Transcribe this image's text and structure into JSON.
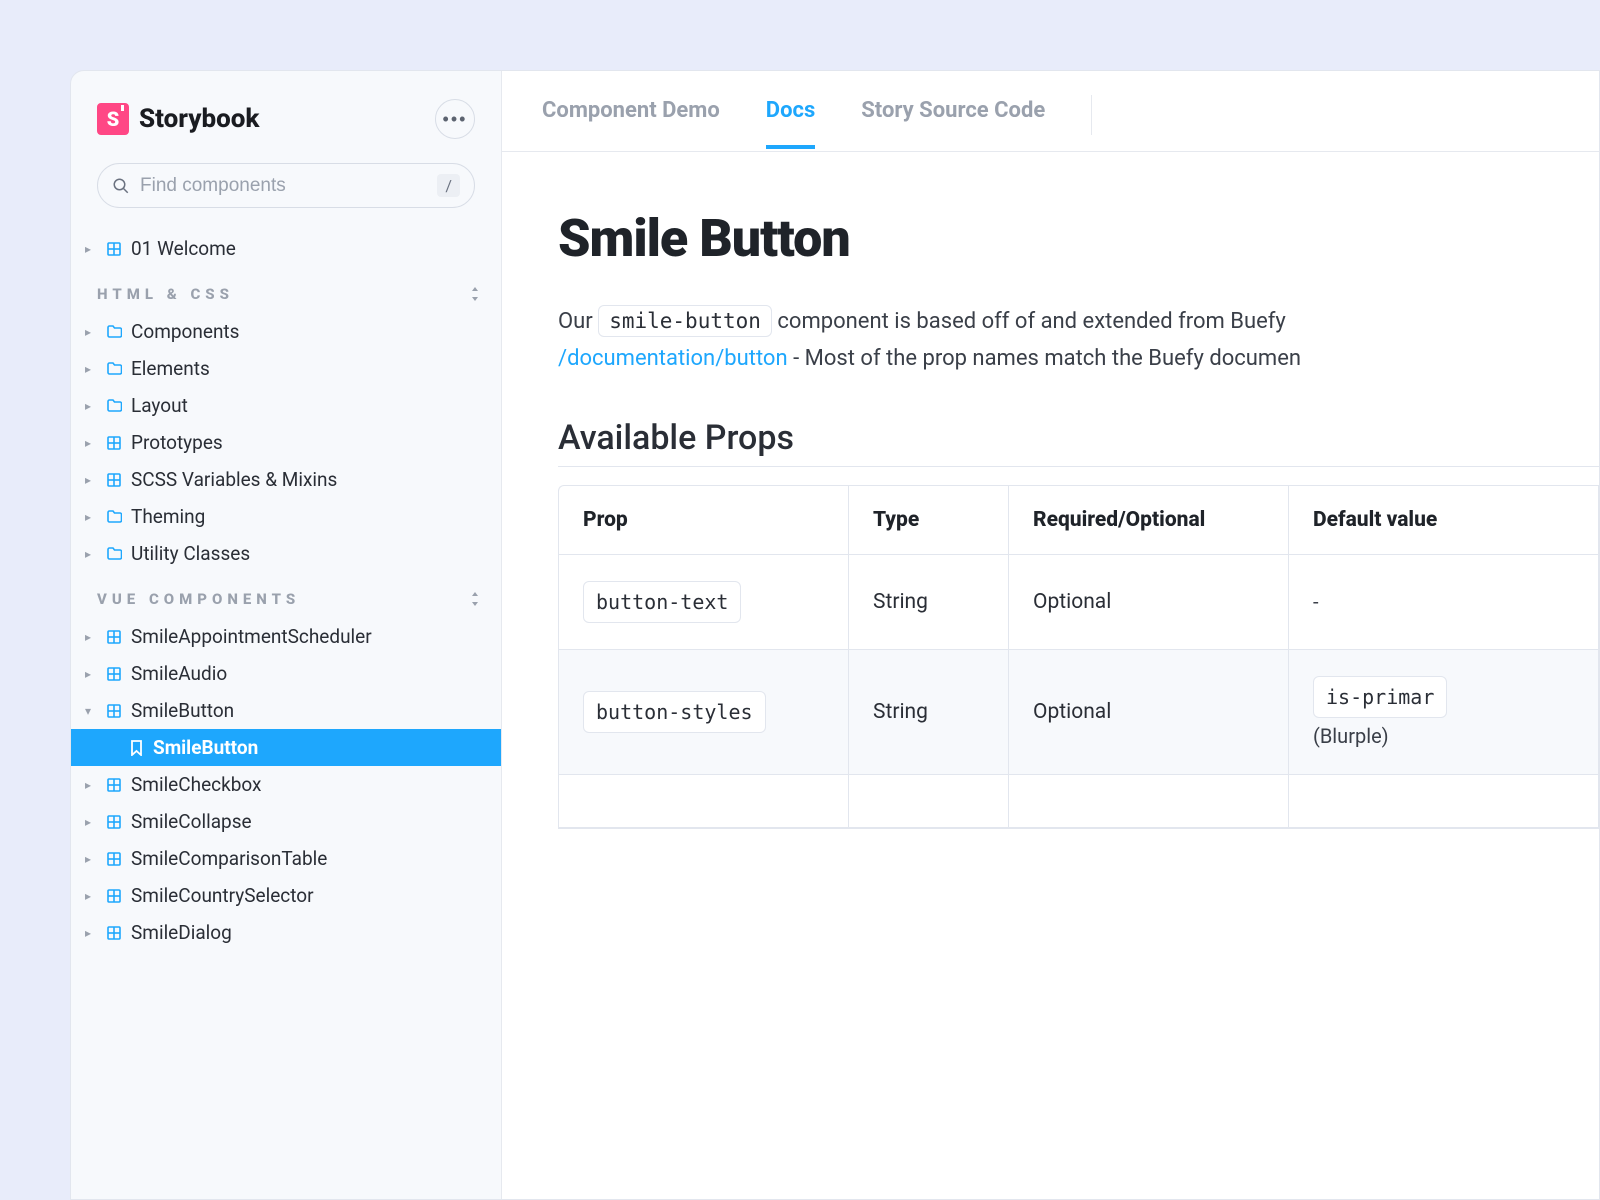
{
  "brand": {
    "name": "Storybook",
    "logo_letter": "S"
  },
  "menu_button": "•••",
  "search": {
    "placeholder": "Find components",
    "shortcut": "/"
  },
  "sidebar": {
    "top_item": {
      "label": "01 Welcome",
      "icon": "grid"
    },
    "sections": [
      {
        "title": "HTML & CSS",
        "items": [
          {
            "label": "Components",
            "icon": "folder"
          },
          {
            "label": "Elements",
            "icon": "folder"
          },
          {
            "label": "Layout",
            "icon": "folder"
          },
          {
            "label": "Prototypes",
            "icon": "grid"
          },
          {
            "label": "SCSS Variables & Mixins",
            "icon": "grid"
          },
          {
            "label": "Theming",
            "icon": "folder"
          },
          {
            "label": "Utility Classes",
            "icon": "folder"
          }
        ]
      },
      {
        "title": "VUE COMPONENTS",
        "items": [
          {
            "label": "SmileAppointmentScheduler",
            "icon": "grid"
          },
          {
            "label": "SmileAudio",
            "icon": "grid"
          },
          {
            "label": "SmileButton",
            "icon": "grid",
            "expanded": true,
            "children": [
              {
                "label": "SmileButton",
                "icon": "bookmark",
                "active": true
              }
            ]
          },
          {
            "label": "SmileCheckbox",
            "icon": "grid"
          },
          {
            "label": "SmileCollapse",
            "icon": "grid"
          },
          {
            "label": "SmileComparisonTable",
            "icon": "grid"
          },
          {
            "label": "SmileCountrySelector",
            "icon": "grid"
          },
          {
            "label": "SmileDialog",
            "icon": "grid"
          }
        ]
      }
    ]
  },
  "tabs": [
    {
      "label": "Component Demo",
      "active": false
    },
    {
      "label": "Docs",
      "active": true
    },
    {
      "label": "Story Source Code",
      "active": false
    }
  ],
  "doc": {
    "title": "Smile Button",
    "intro_prefix": "Our ",
    "intro_code": "smile-button",
    "intro_mid": " component is based off of and extended from Buefy",
    "intro_link": "/documentation/button",
    "intro_suffix": " - Most of the prop names match the Buefy documen",
    "props_heading": "Available Props",
    "columns": [
      "Prop",
      "Type",
      "Required/Optional",
      "Default value"
    ],
    "rows": [
      {
        "prop": "button-text",
        "type": "String",
        "req": "Optional",
        "default_code": "",
        "default_text": "-"
      },
      {
        "prop": "button-styles",
        "type": "String",
        "req": "Optional",
        "default_code": "is-primar",
        "default_text": "(Blurple)"
      },
      {
        "prop": "",
        "type": "",
        "req": "",
        "default_code": "",
        "default_text": ""
      }
    ]
  }
}
